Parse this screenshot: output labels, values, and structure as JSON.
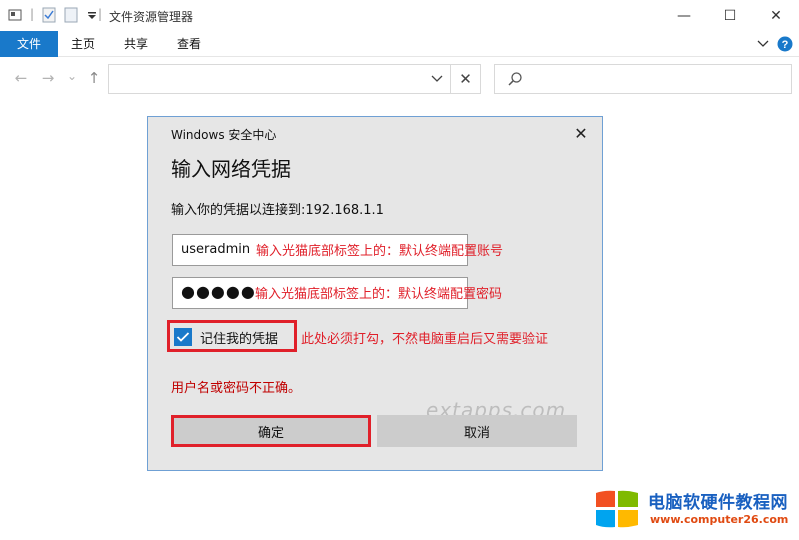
{
  "window": {
    "title": "文件资源管理器",
    "minimize_glyph": "—",
    "maximize_glyph": "☐",
    "close_glyph": "✕"
  },
  "ribbon": {
    "tabs": [
      {
        "label": "文件",
        "active": true
      },
      {
        "label": "主页"
      },
      {
        "label": "共享"
      },
      {
        "label": "查看"
      }
    ]
  },
  "nav": {
    "back_glyph": "←",
    "forward_glyph": "→",
    "recent_glyph": "⌄",
    "up_glyph": "↑",
    "clear_glyph": "✕"
  },
  "dialog": {
    "caption": "Windows 安全中心",
    "close_glyph": "✕",
    "heading": "输入网络凭据",
    "prompt": "输入你的凭据以连接到:192.168.1.1",
    "username_value": "useradmin",
    "password_value": "●●●●●",
    "remember_label": "记住我的凭据",
    "remember_checked": true,
    "error_text": "用户名或密码不正确。",
    "ok_label": "确定",
    "cancel_label": "取消"
  },
  "annotations": {
    "username_note": "输入光猫底部标签上的：默认终端配置账号",
    "password_note": "输入光猫底部标签上的：默认终端配置密码",
    "remember_note": "此处必须打勾，不然电脑重启后又需要验证"
  },
  "watermark": "extapps.com",
  "brand": {
    "name": "电脑软硬件教程网",
    "url": "www.computer26.com"
  },
  "colors": {
    "accent": "#1979ca",
    "annotation": "#e0202a",
    "error": "#c00000"
  }
}
